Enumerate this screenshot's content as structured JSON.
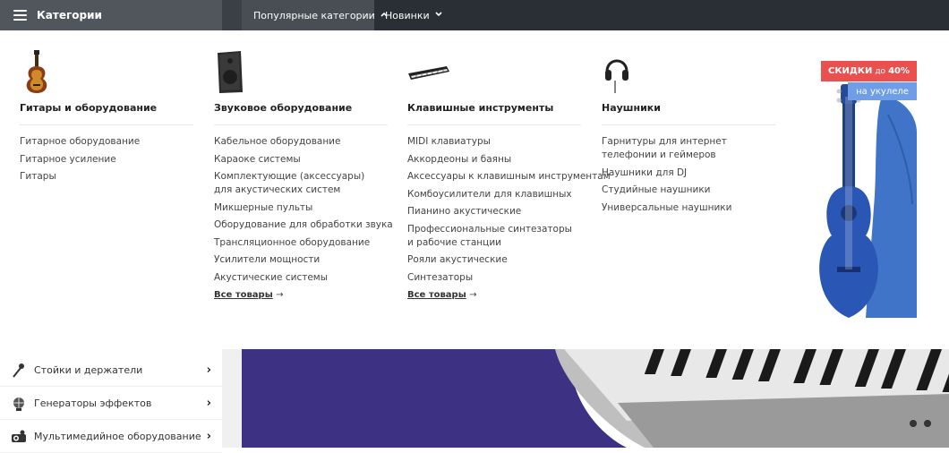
{
  "topbar": {
    "categories_label": "Категории",
    "nav": [
      {
        "label": "Популярные категории",
        "chevron": "up"
      },
      {
        "label": "Новинки",
        "chevron": "down"
      }
    ]
  },
  "columns": [
    {
      "icon": "guitar-icon",
      "title": "Гитары и оборудование",
      "items": [
        "Гитарное оборудование",
        "Гитарное усиление",
        "Гитары"
      ],
      "all_link": ""
    },
    {
      "icon": "speaker-icon",
      "title": "Звуковое оборудование",
      "items": [
        "Кабельное оборудование",
        "Караоке системы",
        "Комплектующие (аксессуары) для акустических систем",
        "Микшерные пульты",
        "Оборудование для обработки звука",
        "Трансляционное оборудование",
        "Усилители мощности",
        "Акустические системы"
      ],
      "all_link": "Все товары"
    },
    {
      "icon": "keyboard-icon",
      "title": "Клавишные инструменты",
      "items": [
        "MIDI клавиатуры",
        "Аккордеоны и баяны",
        "Аксессуары к клавишным инструментам",
        "Комбоусилители для клавишных",
        "Пианино акустические",
        "Профессиональные синтезаторы и рабочие станции",
        "Рояли акустические",
        "Синтезаторы"
      ],
      "all_link": "Все товары"
    },
    {
      "icon": "headphones-icon",
      "title": "Наушники",
      "items": [
        "Гарнитуры для интернет телефонии и геймеров",
        "Наушники для DJ",
        "Студийные наушники",
        "Универсальные наушники"
      ],
      "all_link": ""
    }
  ],
  "promo": {
    "badge_main": "СКИДКИ",
    "badge_small": "до",
    "badge_percent": "40%",
    "badge_sub": "на укулеле",
    "colors": {
      "red": "#e9504e",
      "blue": "#6f9ee6"
    }
  },
  "sidebar": {
    "items": [
      {
        "label": "Стойки и держатели",
        "icon": "microphone-stand-icon"
      },
      {
        "label": "Генераторы эффектов",
        "icon": "disco-ball-icon"
      },
      {
        "label": "Мультимедийное оборудование",
        "icon": "projector-icon"
      }
    ]
  },
  "slider": {
    "count": 2,
    "active": 1
  },
  "colors": {
    "topbar": "#2a2f35",
    "category_button": "#50565c",
    "banner_purple": "#3d3184"
  }
}
